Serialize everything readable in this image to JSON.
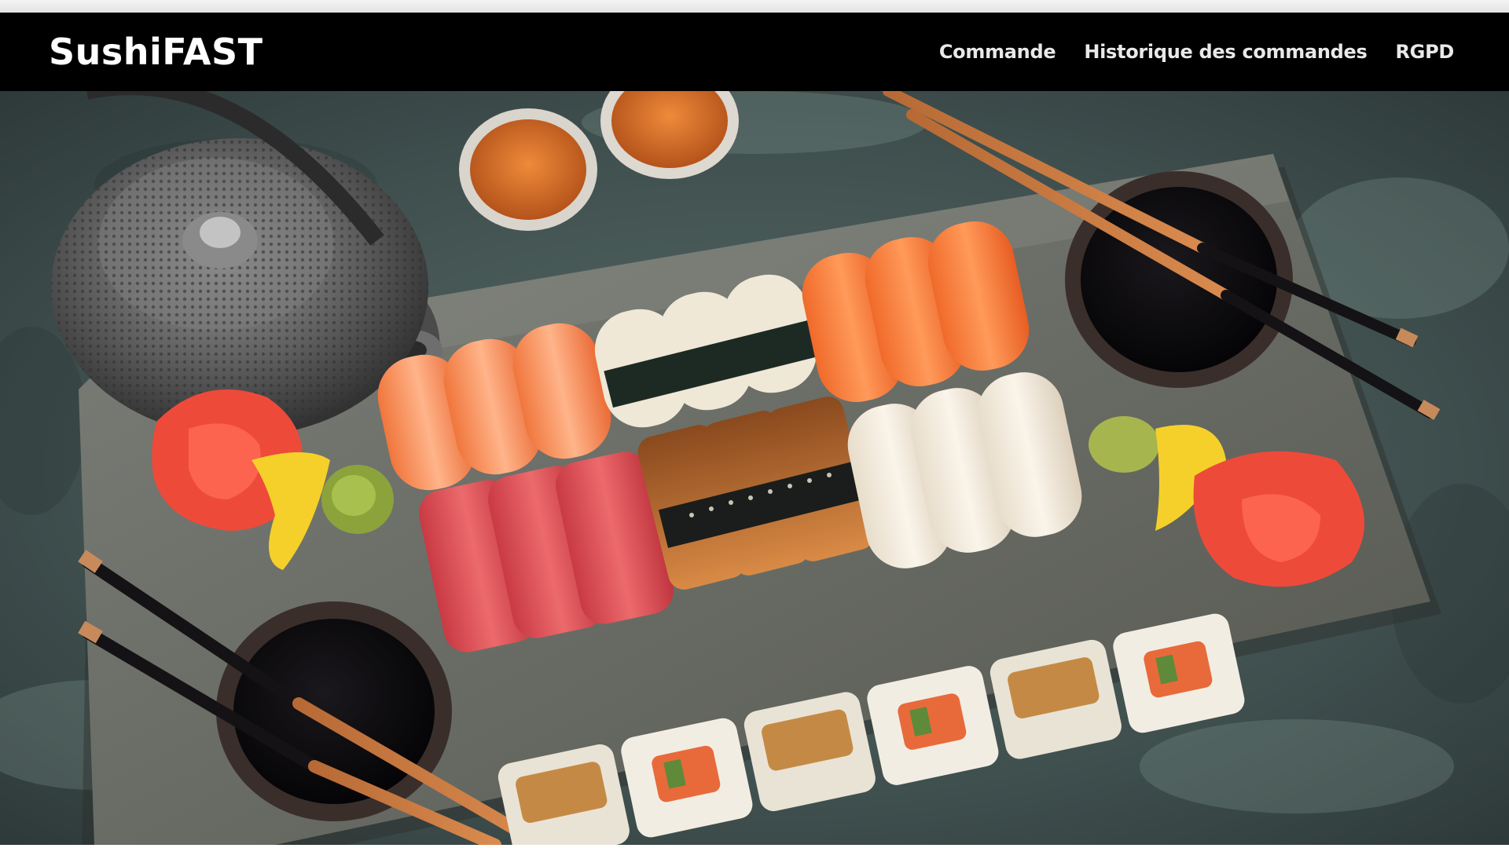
{
  "navbar": {
    "brand": "SushiFAST",
    "links": [
      {
        "label": "Commande"
      },
      {
        "label": "Historique des commandes"
      },
      {
        "label": "RGPD"
      }
    ]
  },
  "hero": {
    "image_subject": "sushi-platter-photo",
    "colors": {
      "background": "#425252",
      "slate": "#6b6e66",
      "salmon": "#f47a3a",
      "tuna": "#d9464e",
      "soy": "#0c0b0d"
    }
  }
}
